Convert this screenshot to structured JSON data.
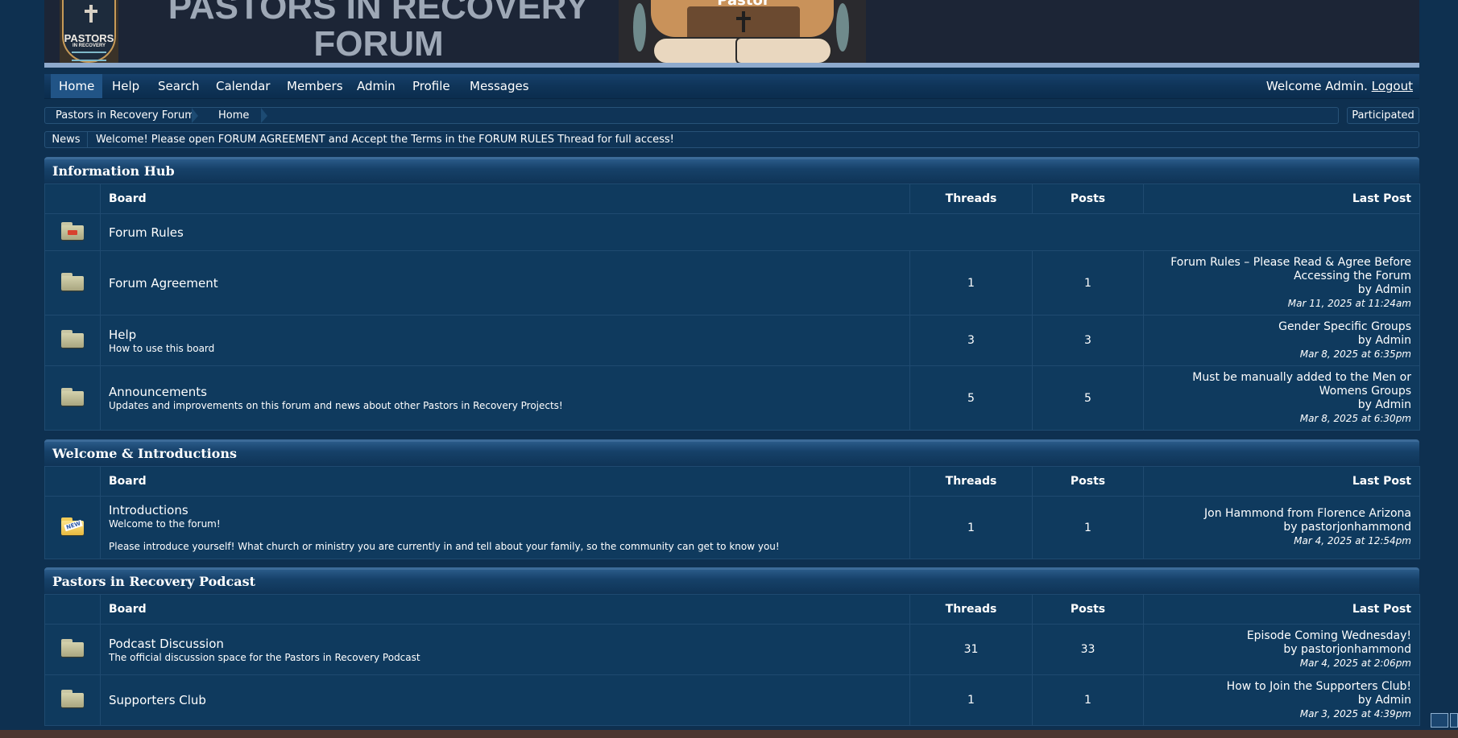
{
  "banner": {
    "logo_line1": "PASTORS",
    "logo_line2": "IN RECOVERY",
    "title": "PASTORS IN RECOVERY FORUM",
    "art_word": "Pastor"
  },
  "nav": {
    "items": [
      "Home",
      "Help",
      "Search",
      "Calendar",
      "Members",
      "Admin",
      "Profile",
      "Messages"
    ],
    "welcome": "Welcome Admin.",
    "logout": "Logout"
  },
  "breadcrumb": {
    "items": [
      "Pastors in Recovery Forum",
      "Home"
    ],
    "participated": "Participated"
  },
  "news": {
    "label": "News",
    "text": "Welcome! Please open FORUM AGREEMENT and Accept the Terms in the FORUM RULES Thread for full access!"
  },
  "headers": {
    "board": "Board",
    "threads": "Threads",
    "posts": "Posts",
    "last_post": "Last Post"
  },
  "categories": [
    {
      "title": "Information Hub",
      "boards": [
        {
          "icon": "folder-redirect-icon",
          "name": "Forum Rules",
          "desc": "",
          "desc2": "",
          "threads": "",
          "posts": "",
          "last_title": "",
          "last_by": "",
          "last_date": ""
        },
        {
          "icon": "folder-icon",
          "name": "Forum Agreement",
          "desc": "",
          "desc2": "",
          "threads": "1",
          "posts": "1",
          "last_title": "Forum Rules – Please Read & Agree Before Accessing the Forum",
          "last_by": "by Admin",
          "last_date": "Mar 11, 2025 at 11:24am"
        },
        {
          "icon": "folder-icon",
          "name": "Help",
          "desc": "How to use this board",
          "desc2": "",
          "threads": "3",
          "posts": "3",
          "last_title": "Gender Specific Groups",
          "last_by": "by Admin",
          "last_date": "Mar 8, 2025 at 6:35pm"
        },
        {
          "icon": "folder-icon",
          "name": "Announcements",
          "desc": "Updates and improvements on this forum and news about other Pastors in Recovery Projects!",
          "desc2": "",
          "threads": "5",
          "posts": "5",
          "last_title": "Must be manually added to the Men or Womens Groups",
          "last_by": "by Admin",
          "last_date": "Mar 8, 2025 at 6:30pm"
        }
      ]
    },
    {
      "title": "Welcome & Introductions",
      "boards": [
        {
          "icon": "folder-new-icon",
          "name": "Introductions",
          "desc": "Welcome to the forum!",
          "desc2": "Please introduce yourself! What church or ministry you are currently in and tell about your family, so the community can get to know you!",
          "threads": "1",
          "posts": "1",
          "last_title": "Jon Hammond from Florence Arizona",
          "last_by": "by pastorjonhammond",
          "last_date": "Mar 4, 2025 at 12:54pm"
        }
      ]
    },
    {
      "title": "Pastors in Recovery Podcast",
      "boards": [
        {
          "icon": "folder-icon",
          "name": "Podcast Discussion",
          "desc": "The official discussion space for the Pastors in Recovery Podcast",
          "desc2": "",
          "threads": "31",
          "posts": "33",
          "last_title": "Episode Coming Wednesday!",
          "last_by": "by pastorjonhammond",
          "last_date": "Mar 4, 2025 at 2:06pm"
        },
        {
          "icon": "folder-icon",
          "name": "Supporters Club",
          "desc": "",
          "desc2": "",
          "threads": "1",
          "posts": "1",
          "last_title": "How to Join the Supporters Club!",
          "last_by": "by Admin",
          "last_date": "Mar 3, 2025 at 4:39pm"
        }
      ]
    }
  ]
}
